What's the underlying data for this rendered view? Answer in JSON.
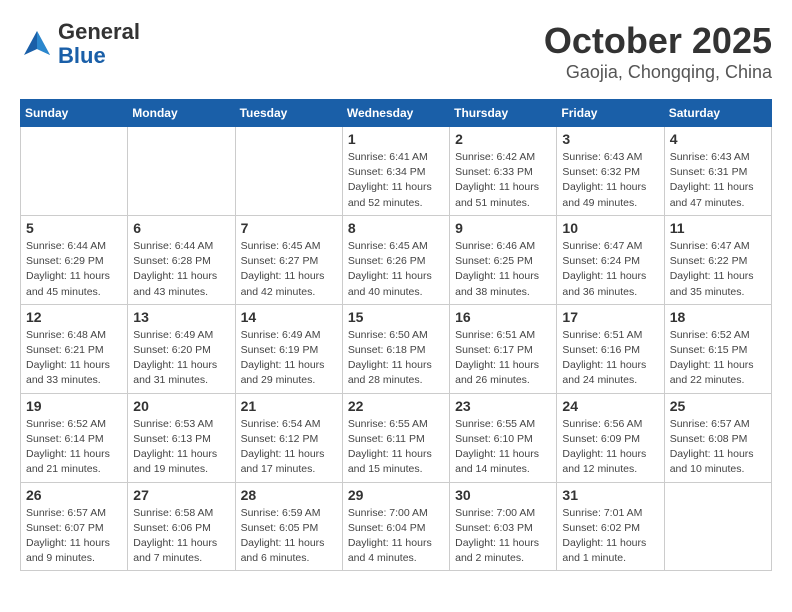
{
  "header": {
    "logo_general": "General",
    "logo_blue": "Blue",
    "month": "October 2025",
    "location": "Gaojia, Chongqing, China"
  },
  "weekdays": [
    "Sunday",
    "Monday",
    "Tuesday",
    "Wednesday",
    "Thursday",
    "Friday",
    "Saturday"
  ],
  "weeks": [
    [
      {
        "day": "",
        "info": ""
      },
      {
        "day": "",
        "info": ""
      },
      {
        "day": "",
        "info": ""
      },
      {
        "day": "1",
        "info": "Sunrise: 6:41 AM\nSunset: 6:34 PM\nDaylight: 11 hours\nand 52 minutes."
      },
      {
        "day": "2",
        "info": "Sunrise: 6:42 AM\nSunset: 6:33 PM\nDaylight: 11 hours\nand 51 minutes."
      },
      {
        "day": "3",
        "info": "Sunrise: 6:43 AM\nSunset: 6:32 PM\nDaylight: 11 hours\nand 49 minutes."
      },
      {
        "day": "4",
        "info": "Sunrise: 6:43 AM\nSunset: 6:31 PM\nDaylight: 11 hours\nand 47 minutes."
      }
    ],
    [
      {
        "day": "5",
        "info": "Sunrise: 6:44 AM\nSunset: 6:29 PM\nDaylight: 11 hours\nand 45 minutes."
      },
      {
        "day": "6",
        "info": "Sunrise: 6:44 AM\nSunset: 6:28 PM\nDaylight: 11 hours\nand 43 minutes."
      },
      {
        "day": "7",
        "info": "Sunrise: 6:45 AM\nSunset: 6:27 PM\nDaylight: 11 hours\nand 42 minutes."
      },
      {
        "day": "8",
        "info": "Sunrise: 6:45 AM\nSunset: 6:26 PM\nDaylight: 11 hours\nand 40 minutes."
      },
      {
        "day": "9",
        "info": "Sunrise: 6:46 AM\nSunset: 6:25 PM\nDaylight: 11 hours\nand 38 minutes."
      },
      {
        "day": "10",
        "info": "Sunrise: 6:47 AM\nSunset: 6:24 PM\nDaylight: 11 hours\nand 36 minutes."
      },
      {
        "day": "11",
        "info": "Sunrise: 6:47 AM\nSunset: 6:22 PM\nDaylight: 11 hours\nand 35 minutes."
      }
    ],
    [
      {
        "day": "12",
        "info": "Sunrise: 6:48 AM\nSunset: 6:21 PM\nDaylight: 11 hours\nand 33 minutes."
      },
      {
        "day": "13",
        "info": "Sunrise: 6:49 AM\nSunset: 6:20 PM\nDaylight: 11 hours\nand 31 minutes."
      },
      {
        "day": "14",
        "info": "Sunrise: 6:49 AM\nSunset: 6:19 PM\nDaylight: 11 hours\nand 29 minutes."
      },
      {
        "day": "15",
        "info": "Sunrise: 6:50 AM\nSunset: 6:18 PM\nDaylight: 11 hours\nand 28 minutes."
      },
      {
        "day": "16",
        "info": "Sunrise: 6:51 AM\nSunset: 6:17 PM\nDaylight: 11 hours\nand 26 minutes."
      },
      {
        "day": "17",
        "info": "Sunrise: 6:51 AM\nSunset: 6:16 PM\nDaylight: 11 hours\nand 24 minutes."
      },
      {
        "day": "18",
        "info": "Sunrise: 6:52 AM\nSunset: 6:15 PM\nDaylight: 11 hours\nand 22 minutes."
      }
    ],
    [
      {
        "day": "19",
        "info": "Sunrise: 6:52 AM\nSunset: 6:14 PM\nDaylight: 11 hours\nand 21 minutes."
      },
      {
        "day": "20",
        "info": "Sunrise: 6:53 AM\nSunset: 6:13 PM\nDaylight: 11 hours\nand 19 minutes."
      },
      {
        "day": "21",
        "info": "Sunrise: 6:54 AM\nSunset: 6:12 PM\nDaylight: 11 hours\nand 17 minutes."
      },
      {
        "day": "22",
        "info": "Sunrise: 6:55 AM\nSunset: 6:11 PM\nDaylight: 11 hours\nand 15 minutes."
      },
      {
        "day": "23",
        "info": "Sunrise: 6:55 AM\nSunset: 6:10 PM\nDaylight: 11 hours\nand 14 minutes."
      },
      {
        "day": "24",
        "info": "Sunrise: 6:56 AM\nSunset: 6:09 PM\nDaylight: 11 hours\nand 12 minutes."
      },
      {
        "day": "25",
        "info": "Sunrise: 6:57 AM\nSunset: 6:08 PM\nDaylight: 11 hours\nand 10 minutes."
      }
    ],
    [
      {
        "day": "26",
        "info": "Sunrise: 6:57 AM\nSunset: 6:07 PM\nDaylight: 11 hours\nand 9 minutes."
      },
      {
        "day": "27",
        "info": "Sunrise: 6:58 AM\nSunset: 6:06 PM\nDaylight: 11 hours\nand 7 minutes."
      },
      {
        "day": "28",
        "info": "Sunrise: 6:59 AM\nSunset: 6:05 PM\nDaylight: 11 hours\nand 6 minutes."
      },
      {
        "day": "29",
        "info": "Sunrise: 7:00 AM\nSunset: 6:04 PM\nDaylight: 11 hours\nand 4 minutes."
      },
      {
        "day": "30",
        "info": "Sunrise: 7:00 AM\nSunset: 6:03 PM\nDaylight: 11 hours\nand 2 minutes."
      },
      {
        "day": "31",
        "info": "Sunrise: 7:01 AM\nSunset: 6:02 PM\nDaylight: 11 hours\nand 1 minute."
      },
      {
        "day": "",
        "info": ""
      }
    ]
  ]
}
